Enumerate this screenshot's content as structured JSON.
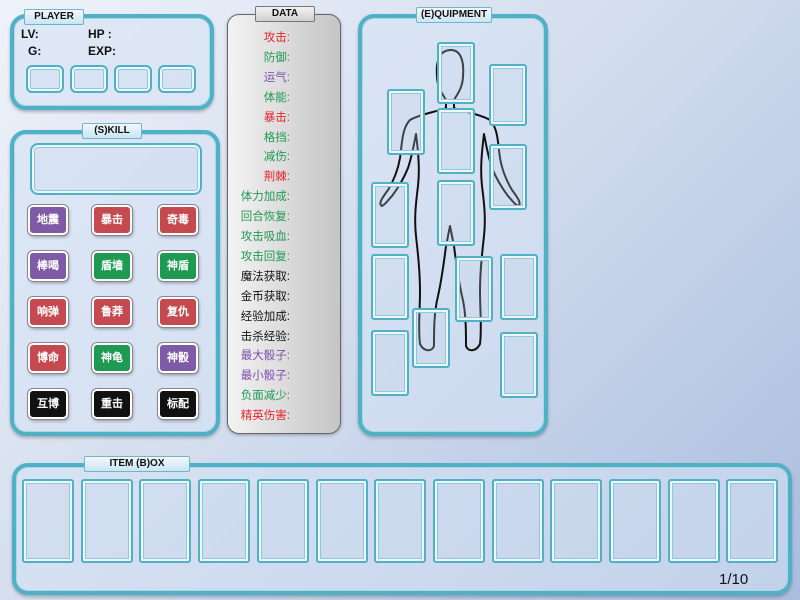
{
  "player": {
    "tab": "PLAYER",
    "lv_label": "LV:",
    "hp_label": "HP :",
    "g_label": "G:",
    "exp_label": "EXP:"
  },
  "skill": {
    "tab": "(S)KILL",
    "buttons": [
      {
        "label": "地震",
        "color": "#7f5aa6"
      },
      {
        "label": "暴击",
        "color": "#c44a4f"
      },
      {
        "label": "奇毒",
        "color": "#c44a4f"
      },
      {
        "label": "棒喝",
        "color": "#7f5aa6"
      },
      {
        "label": "盾墙",
        "color": "#1f9a52"
      },
      {
        "label": "神盾",
        "color": "#1f9a52"
      },
      {
        "label": "响弹",
        "color": "#c44a4f"
      },
      {
        "label": "鲁莽",
        "color": "#c44a4f"
      },
      {
        "label": "复仇",
        "color": "#c44a4f"
      },
      {
        "label": "博命",
        "color": "#c44a4f"
      },
      {
        "label": "神龟",
        "color": "#1f9a52"
      },
      {
        "label": "神骰",
        "color": "#7f5aa6"
      },
      {
        "label": "互博",
        "color": "#111111"
      },
      {
        "label": "重击",
        "color": "#111111"
      },
      {
        "label": "标配",
        "color": "#111111"
      }
    ]
  },
  "data": {
    "tab": "DATA",
    "rows": [
      {
        "label": "攻击:",
        "color": "#e5252a"
      },
      {
        "label": "防御:",
        "color": "#1f9a52"
      },
      {
        "label": "运气:",
        "color": "#7d4fb0"
      },
      {
        "label": "体能:",
        "color": "#1f9a52"
      },
      {
        "label": "暴击:",
        "color": "#e5252a"
      },
      {
        "label": "格挡:",
        "color": "#1f9a52"
      },
      {
        "label": "减伤:",
        "color": "#1f9a52"
      },
      {
        "label": "荆棘:",
        "color": "#e5252a"
      },
      {
        "label": "体力加成:",
        "color": "#1f9a52"
      },
      {
        "label": "回合恢复:",
        "color": "#1f9a52"
      },
      {
        "label": "攻击吸血:",
        "color": "#1f9a52"
      },
      {
        "label": "攻击回复:",
        "color": "#1f9a52"
      },
      {
        "label": "魔法获取:",
        "color": "#111111"
      },
      {
        "label": "金币获取:",
        "color": "#111111"
      },
      {
        "label": "经验加成:",
        "color": "#111111"
      },
      {
        "label": "击杀经验:",
        "color": "#111111"
      },
      {
        "label": "最大骰子:",
        "color": "#7d4fb0"
      },
      {
        "label": "最小骰子:",
        "color": "#7d4fb0"
      },
      {
        "label": "负面减少:",
        "color": "#1f9a52"
      },
      {
        "label": "精英伤害:",
        "color": "#e5252a"
      }
    ]
  },
  "equipment": {
    "tab": "(E)QUIPMENT"
  },
  "itembox": {
    "tab": "ITEM (B)OX",
    "page": "1/10"
  }
}
